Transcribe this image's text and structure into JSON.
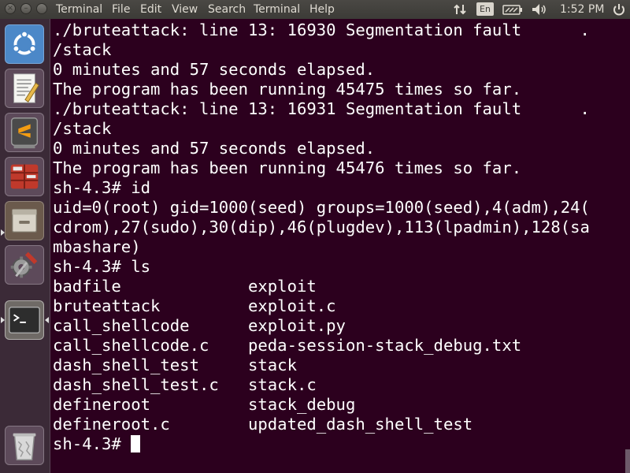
{
  "topbar": {
    "menus": [
      "Terminal",
      "File",
      "Edit",
      "View",
      "Search",
      "Terminal",
      "Help"
    ],
    "keyboard_layout": "En",
    "clock": "1:52 PM",
    "indicators": [
      "network-arrows-icon",
      "keyboard-icon",
      "battery-icon",
      "volume-icon",
      "power-icon"
    ]
  },
  "launcher": {
    "items": [
      "ubuntu-dash-icon",
      "text-editor-icon",
      "sublime-text-icon",
      "spreadsheet-icon",
      "file-manager-icon",
      "system-settings-icon",
      "terminal-icon",
      "trash-icon"
    ]
  },
  "terminal": {
    "lines": [
      "./bruteattack: line 13: 16930 Segmentation fault      .",
      "/stack",
      "0 minutes and 57 seconds elapsed.",
      "The program has been running 45475 times so far.",
      "./bruteattack: line 13: 16931 Segmentation fault      .",
      "/stack",
      "0 minutes and 57 seconds elapsed.",
      "The program has been running 45476 times so far.",
      "sh-4.3# id",
      "uid=0(root) gid=1000(seed) groups=1000(seed),4(adm),24(",
      "cdrom),27(sudo),30(dip),46(plugdev),113(lpadmin),128(sa",
      "mbashare)",
      "sh-4.3# ls",
      "badfile             exploit",
      "bruteattack         exploit.c",
      "call_shellcode      exploit.py",
      "call_shellcode.c    peda-session-stack_debug.txt",
      "dash_shell_test     stack",
      "dash_shell_test.c   stack.c",
      "defineroot          stack_debug",
      "defineroot.c        updated_dash_shell_test"
    ],
    "prompt": "sh-4.3# "
  },
  "colors": {
    "terminal_bg": "#2c001e",
    "terminal_fg": "#ffffff",
    "panel_bg": "#3c3b37",
    "launcher_bg": "#3b2a37"
  }
}
